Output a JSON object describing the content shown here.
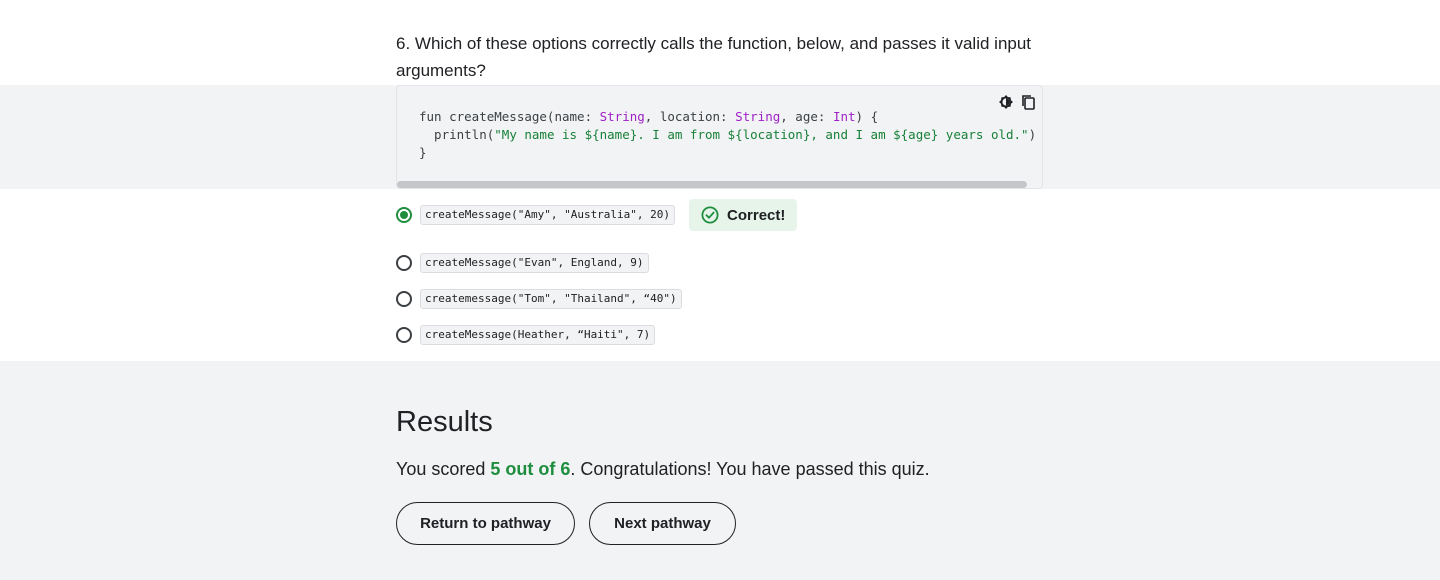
{
  "question": {
    "number": "6.",
    "text": "Which of these options correctly calls the function, below, and passes it valid input arguments?"
  },
  "code_tools": {
    "theme_icon": "contrast-icon",
    "copy_icon": "copy-icon"
  },
  "code": {
    "line1_a": "fun createMessage(name: ",
    "line1_type1": "String",
    "line1_b": ", location: ",
    "line1_type2": "String",
    "line1_c": ", age: ",
    "line1_type3": "Int",
    "line1_d": ") {",
    "line2_a": "  println(",
    "line2_str": "\"My name is ${name}. I am from ${location}, and I am ${age} years old.\"",
    "line2_b": ")",
    "line3": "}"
  },
  "options": [
    {
      "code": "createMessage(\"Amy\", \"Australia\", 20)",
      "selected": true
    },
    {
      "code": "createMessage(\"Evan\", England, 9)",
      "selected": false
    },
    {
      "code": "createmessage(\"Tom\", \"Thailand\", “40\")",
      "selected": false
    },
    {
      "code": "createMessage(Heather, “Haiti\", 7)",
      "selected": false
    }
  ],
  "feedback": {
    "label": "Correct!",
    "icon": "check-circle-icon",
    "color": "#1e8e3e"
  },
  "results": {
    "title": "Results",
    "prefix": "You scored ",
    "score": "5 out of 6",
    "suffix": ". Congratulations! You have passed this quiz.",
    "return_label": "Return to pathway",
    "next_label": "Next pathway"
  },
  "colors": {
    "accent_green": "#1e8e3e",
    "feedback_bg": "#e6f4ea",
    "band_bg": "#f1f3f4"
  }
}
